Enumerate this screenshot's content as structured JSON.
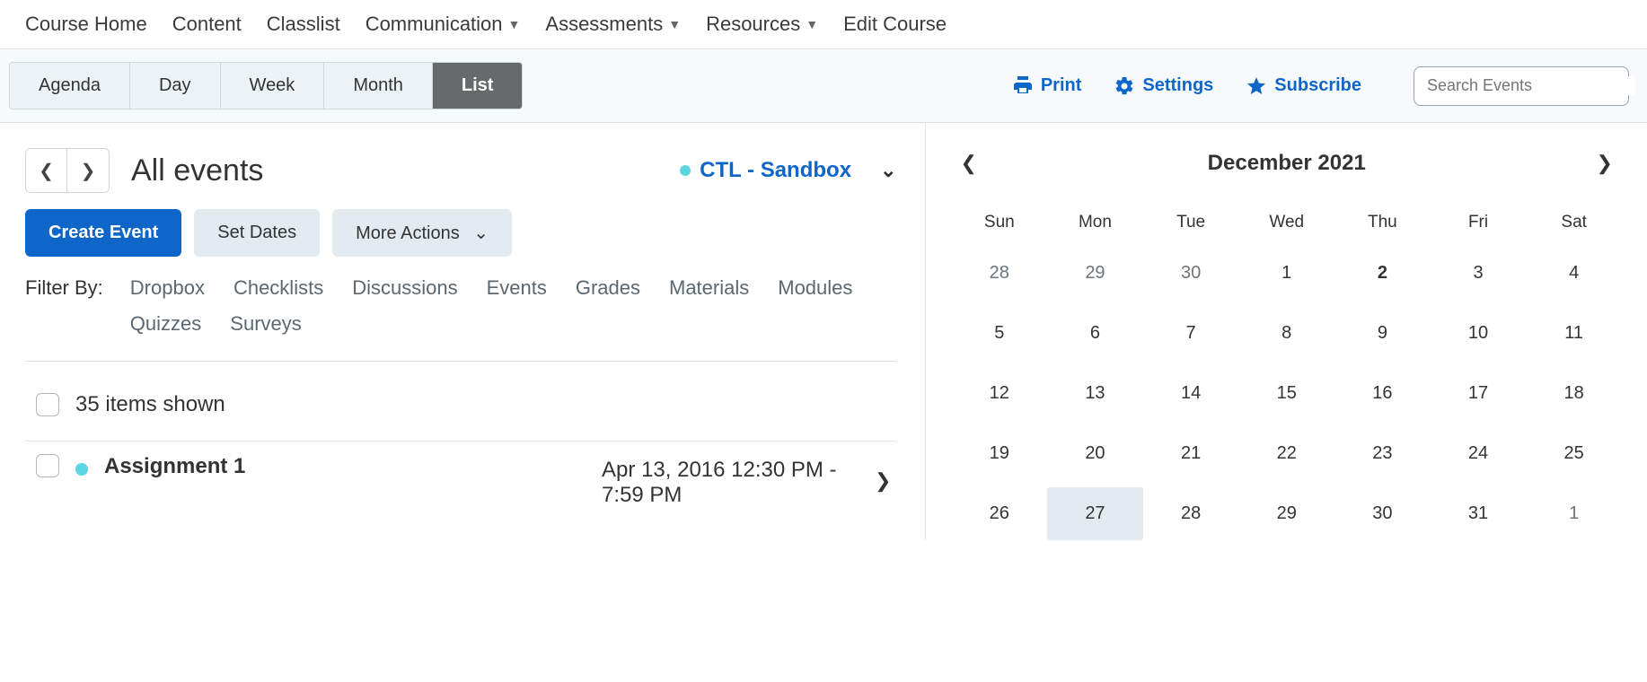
{
  "topNav": {
    "items": [
      {
        "label": "Course Home",
        "dropdown": false
      },
      {
        "label": "Content",
        "dropdown": false
      },
      {
        "label": "Classlist",
        "dropdown": false
      },
      {
        "label": "Communication",
        "dropdown": true
      },
      {
        "label": "Assessments",
        "dropdown": true
      },
      {
        "label": "Resources",
        "dropdown": true
      },
      {
        "label": "Edit Course",
        "dropdown": false
      }
    ]
  },
  "viewTabs": {
    "items": [
      {
        "label": "Agenda",
        "active": false
      },
      {
        "label": "Day",
        "active": false
      },
      {
        "label": "Week",
        "active": false
      },
      {
        "label": "Month",
        "active": false
      },
      {
        "label": "List",
        "active": true
      }
    ]
  },
  "toolLinks": {
    "print": "Print",
    "settings": "Settings",
    "subscribe": "Subscribe"
  },
  "search": {
    "placeholder": "Search Events"
  },
  "header": {
    "title": "All events",
    "course": "CTL - Sandbox"
  },
  "actions": {
    "create": "Create Event",
    "setDates": "Set Dates",
    "moreActions": "More Actions"
  },
  "filters": {
    "label": "Filter By:",
    "items": [
      "Dropbox",
      "Checklists",
      "Discussions",
      "Events",
      "Grades",
      "Materials",
      "Modules",
      "Quizzes",
      "Surveys"
    ]
  },
  "list": {
    "count": "35 items shown",
    "items": [
      {
        "title": "Assignment 1",
        "date": "Apr 13, 2016 12:30 PM - 7:59 PM"
      }
    ]
  },
  "calendar": {
    "title": "December 2021",
    "dayHeaders": [
      "Sun",
      "Mon",
      "Tue",
      "Wed",
      "Thu",
      "Fri",
      "Sat"
    ],
    "cells": [
      {
        "d": "28",
        "in": false
      },
      {
        "d": "29",
        "in": false
      },
      {
        "d": "30",
        "in": false
      },
      {
        "d": "1",
        "in": true
      },
      {
        "d": "2",
        "in": true,
        "bold": true
      },
      {
        "d": "3",
        "in": true
      },
      {
        "d": "4",
        "in": true
      },
      {
        "d": "5",
        "in": true
      },
      {
        "d": "6",
        "in": true
      },
      {
        "d": "7",
        "in": true
      },
      {
        "d": "8",
        "in": true
      },
      {
        "d": "9",
        "in": true
      },
      {
        "d": "10",
        "in": true
      },
      {
        "d": "11",
        "in": true
      },
      {
        "d": "12",
        "in": true
      },
      {
        "d": "13",
        "in": true
      },
      {
        "d": "14",
        "in": true
      },
      {
        "d": "15",
        "in": true
      },
      {
        "d": "16",
        "in": true
      },
      {
        "d": "17",
        "in": true
      },
      {
        "d": "18",
        "in": true
      },
      {
        "d": "19",
        "in": true
      },
      {
        "d": "20",
        "in": true
      },
      {
        "d": "21",
        "in": true
      },
      {
        "d": "22",
        "in": true
      },
      {
        "d": "23",
        "in": true
      },
      {
        "d": "24",
        "in": true
      },
      {
        "d": "25",
        "in": true
      },
      {
        "d": "26",
        "in": true
      },
      {
        "d": "27",
        "in": true,
        "today": true
      },
      {
        "d": "28",
        "in": true
      },
      {
        "d": "29",
        "in": true
      },
      {
        "d": "30",
        "in": true
      },
      {
        "d": "31",
        "in": true
      },
      {
        "d": "1",
        "in": false
      }
    ]
  }
}
